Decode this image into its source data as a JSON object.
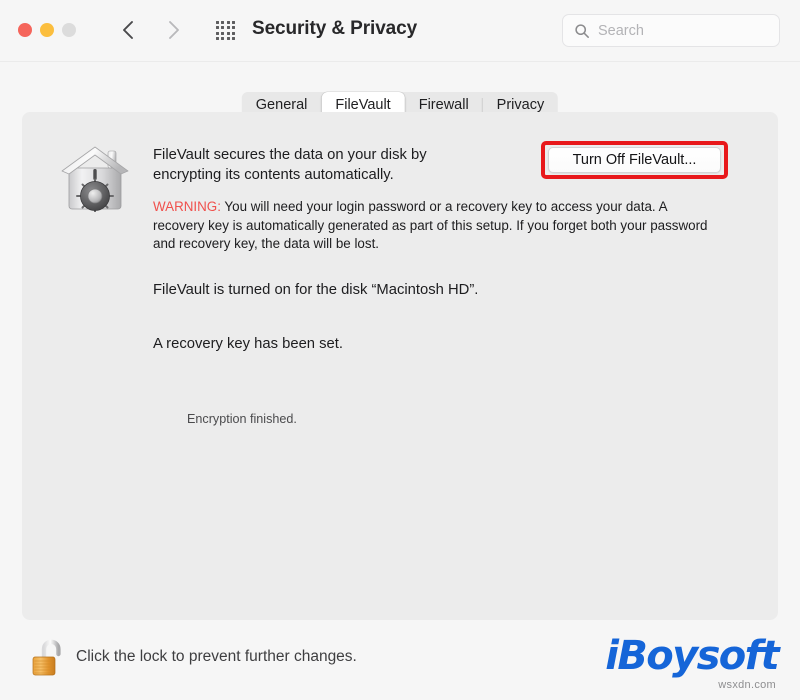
{
  "window": {
    "title": "Security & Privacy",
    "traffic_lights": [
      {
        "name": "close",
        "color": "#f5655b"
      },
      {
        "name": "minimize",
        "color": "#fbbe3e"
      },
      {
        "name": "zoom",
        "color": "#dcdcdc"
      }
    ],
    "nav": {
      "back_label": "Back",
      "forward_label": "Forward"
    },
    "grid_button_label": "Show All"
  },
  "search": {
    "placeholder": "Search",
    "value": ""
  },
  "tabs": [
    {
      "id": "general",
      "label": "General",
      "selected": false
    },
    {
      "id": "filevault",
      "label": "FileVault",
      "selected": true
    },
    {
      "id": "firewall",
      "label": "Firewall",
      "selected": false
    },
    {
      "id": "privacy",
      "label": "Privacy",
      "selected": false
    }
  ],
  "main": {
    "icon_name": "filevault-safe-house-icon",
    "description": "FileVault secures the data on your disk by encrypting its contents automatically.",
    "turn_off_button": "Turn Off FileVault...",
    "highlight_color": "#e8181b",
    "warning_label": "WARNING:",
    "warning_color": "#f0514d",
    "warning_text": " You will need your login password or a recovery key to access your data. A recovery key is automatically generated as part of this setup. If you forget both your password and recovery key, the data will be lost.",
    "status_disk": "FileVault is turned on for the disk “Macintosh HD”.",
    "status_recovery_key": "A recovery key has been set.",
    "status_encryption": "Encryption finished."
  },
  "footer": {
    "lock_icon_name": "unlocked-padlock-icon",
    "lock_text": "Click the lock to prevent further changes."
  },
  "watermark": {
    "logo_text": "iBoysoft",
    "logo_color": "#1565d8",
    "url": "wsxdn.com"
  }
}
